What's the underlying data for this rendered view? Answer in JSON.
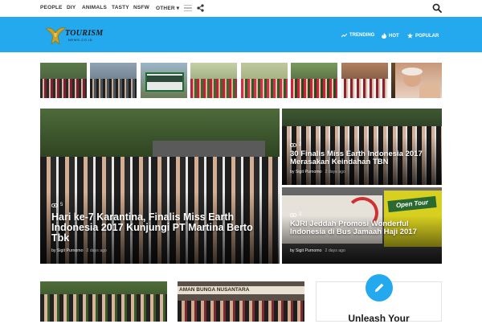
{
  "topnav": {
    "items": [
      "PEOPLE",
      "DIY",
      "ANIMALS",
      "TASTY",
      "NSFW",
      "OTHER ▾"
    ]
  },
  "header": {
    "logo_text": "TOURISM",
    "logo_sub": "NEWS.CO.ID",
    "nav": [
      "TRENDING",
      "HOT",
      "POPULAR"
    ]
  },
  "featured": {
    "views": "5",
    "title": "Hari ke-7 Karantina, Finalis Miss Earth Indonesia 2017 Kunjungi PT Martina Berto Tbk",
    "author": "by Sigit Purnomo",
    "date": "2 days ago"
  },
  "side_posts": [
    {
      "views": "2",
      "title": "30 Finalis Miss Earth Indonesia 2017 Merasakan Keindahan TBN",
      "author": "by Sigit Purnomo",
      "date": "2 days ago"
    },
    {
      "views": "3",
      "title": "KJRI Jeddah Promosi Wonderful Indonesia di Bus Jamaah Haji 2017",
      "author": "by Sigit Purnomo",
      "date": "2 days ago",
      "bus_text": "Open Tour"
    }
  ],
  "bottom": {
    "sign_text": "AMAN BUNGA NUSANTARA"
  },
  "widget": {
    "title": "Unleash Your"
  }
}
